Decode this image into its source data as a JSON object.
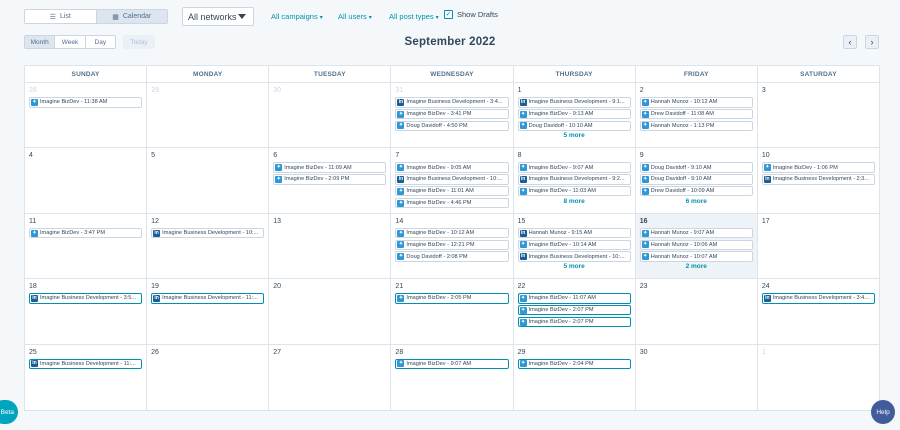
{
  "toolbar": {
    "list_label": "List",
    "calendar_label": "Calendar",
    "network_select": "All networks",
    "campaigns": "All campaigns",
    "users": "All users",
    "post_types": "All post types",
    "show_drafts": "Show Drafts"
  },
  "nav": {
    "month": "Month",
    "week": "Week",
    "day": "Day",
    "today": "Today",
    "title": "September 2022",
    "prev": "‹",
    "next": "›"
  },
  "weekdays": [
    "SUNDAY",
    "MONDAY",
    "TUESDAY",
    "WEDNESDAY",
    "THURSDAY",
    "FRIDAY",
    "SATURDAY"
  ],
  "weeks": [
    [
      {
        "num": "28",
        "other": true,
        "posts": [
          {
            "net": "tw",
            "text": "Imagine BizDev - 11:38 AM"
          }
        ]
      },
      {
        "num": "29",
        "other": true,
        "posts": []
      },
      {
        "num": "30",
        "other": true,
        "posts": []
      },
      {
        "num": "31",
        "other": true,
        "posts": [
          {
            "net": "li",
            "text": "Imagine Business Development - 3:4..."
          },
          {
            "net": "tw",
            "text": "Imagine BizDev - 3:41 PM"
          },
          {
            "net": "tw",
            "text": "Doug Davidoff - 4:50 PM"
          }
        ]
      },
      {
        "num": "1",
        "posts": [
          {
            "net": "li",
            "text": "Imagine Business Development - 9:1..."
          },
          {
            "net": "tw",
            "text": "Imagine BizDev - 9:13 AM"
          },
          {
            "net": "tw",
            "text": "Doug Davidoff - 10:10 AM"
          }
        ],
        "more": "5 more"
      },
      {
        "num": "2",
        "posts": [
          {
            "net": "tw",
            "text": "Hannah Munoz - 10:12 AM"
          },
          {
            "net": "tw",
            "text": "Drew Davidoff - 11:08 AM"
          },
          {
            "net": "tw",
            "text": "Hannah Munoz - 1:13 PM"
          }
        ]
      },
      {
        "num": "3",
        "posts": []
      }
    ],
    [
      {
        "num": "4",
        "posts": []
      },
      {
        "num": "5",
        "posts": []
      },
      {
        "num": "6",
        "posts": [
          {
            "net": "tw",
            "text": "Imagine BizDev - 11:09 AM"
          },
          {
            "net": "tw",
            "text": "Imagine BizDev - 2:09 PM"
          }
        ]
      },
      {
        "num": "7",
        "posts": [
          {
            "net": "tw",
            "text": "Imagine BizDev - 9:05 AM"
          },
          {
            "net": "li",
            "text": "Imagine Business Development - 10:..."
          },
          {
            "net": "tw",
            "text": "Imagine BizDev - 11:01 AM"
          },
          {
            "net": "tw",
            "text": "Imagine BizDev - 4:46 PM"
          }
        ]
      },
      {
        "num": "8",
        "posts": [
          {
            "net": "tw",
            "text": "Imagine BizDev - 9:07 AM"
          },
          {
            "net": "li",
            "text": "Imagine Business Development - 9:2..."
          },
          {
            "net": "tw",
            "text": "Imagine BizDev - 11:03 AM"
          }
        ],
        "more": "8 more"
      },
      {
        "num": "9",
        "posts": [
          {
            "net": "tw",
            "text": "Doug Davidoff - 9:10 AM"
          },
          {
            "net": "tw",
            "text": "Doug Davidoff - 9:10 AM"
          },
          {
            "net": "tw",
            "text": "Drew Davidoff - 10:09 AM"
          }
        ],
        "more": "6 more"
      },
      {
        "num": "10",
        "posts": [
          {
            "net": "tw",
            "text": "Imagine BizDev - 1:06 PM"
          },
          {
            "net": "li",
            "text": "Imagine Business Development - 2:3..."
          }
        ]
      }
    ],
    [
      {
        "num": "11",
        "posts": [
          {
            "net": "tw",
            "text": "Imagine BizDev - 3:47 PM"
          }
        ]
      },
      {
        "num": "12",
        "posts": [
          {
            "net": "li",
            "text": "Imagine Business Development - 10:..."
          }
        ]
      },
      {
        "num": "13",
        "posts": []
      },
      {
        "num": "14",
        "posts": [
          {
            "net": "tw",
            "text": "Imagine BizDev - 10:12 AM"
          },
          {
            "net": "tw",
            "text": "Imagine BizDev - 12:21 PM"
          },
          {
            "net": "tw",
            "text": "Doug Davidoff - 2:08 PM"
          }
        ]
      },
      {
        "num": "15",
        "posts": [
          {
            "net": "li",
            "text": "Hannah Munoz - 9:15 AM"
          },
          {
            "net": "tw",
            "text": "Imagine BizDev - 10:14 AM"
          },
          {
            "net": "li",
            "text": "Imagine Business Development - 10:..."
          }
        ],
        "more": "5 more"
      },
      {
        "num": "16",
        "today": true,
        "posts": [
          {
            "net": "tw",
            "text": "Hannah Munoz - 9:07 AM"
          },
          {
            "net": "tw",
            "text": "Hannah Munoz - 10:06 AM"
          },
          {
            "net": "tw",
            "text": "Hannah Munoz - 10:07 AM"
          }
        ],
        "more": "2 more"
      },
      {
        "num": "17",
        "posts": []
      }
    ],
    [
      {
        "num": "18",
        "posts": [
          {
            "net": "li",
            "text": "Imagine Business Development - 3:5...",
            "hl": true
          }
        ]
      },
      {
        "num": "19",
        "posts": [
          {
            "net": "li",
            "text": "Imagine Business Development - 11:...",
            "hl": true
          }
        ]
      },
      {
        "num": "20",
        "posts": []
      },
      {
        "num": "21",
        "posts": [
          {
            "net": "tw",
            "text": "Imagine BizDev - 2:05 PM",
            "hl": true
          }
        ]
      },
      {
        "num": "22",
        "posts": [
          {
            "net": "tw",
            "text": "Imagine BizDev - 11:07 AM",
            "hl": true
          },
          {
            "net": "tw",
            "text": "Imagine BizDev - 2:07 PM",
            "hl": true
          },
          {
            "net": "tw",
            "text": "Imagine BizDev - 2:07 PM",
            "hl": true
          }
        ]
      },
      {
        "num": "23",
        "posts": []
      },
      {
        "num": "24",
        "posts": [
          {
            "net": "li",
            "text": "Imagine Business Development - 3:4...",
            "hl": true
          }
        ]
      }
    ],
    [
      {
        "num": "25",
        "posts": [
          {
            "net": "li",
            "text": "Imagine Business Development - 11:...",
            "hl": true
          }
        ]
      },
      {
        "num": "26",
        "posts": []
      },
      {
        "num": "27",
        "posts": []
      },
      {
        "num": "28",
        "posts": [
          {
            "net": "tw",
            "text": "Imagine BizDev - 9:07 AM",
            "hl": true
          }
        ]
      },
      {
        "num": "29",
        "posts": [
          {
            "net": "tw",
            "text": "Imagine BizDev - 2:04 PM",
            "hl": true
          }
        ]
      },
      {
        "num": "30",
        "posts": []
      },
      {
        "num": "1",
        "other": true,
        "posts": []
      }
    ]
  ],
  "icons": {
    "twitter": "twitter-icon",
    "linkedin": "linkedin-icon"
  },
  "colors": {
    "accent": "#0091ae",
    "twitter": "#2f97d6",
    "linkedin": "#1b5e96",
    "today_bg": "#eef3f7"
  },
  "footer": {
    "beta": "Beta",
    "help": "Help"
  }
}
